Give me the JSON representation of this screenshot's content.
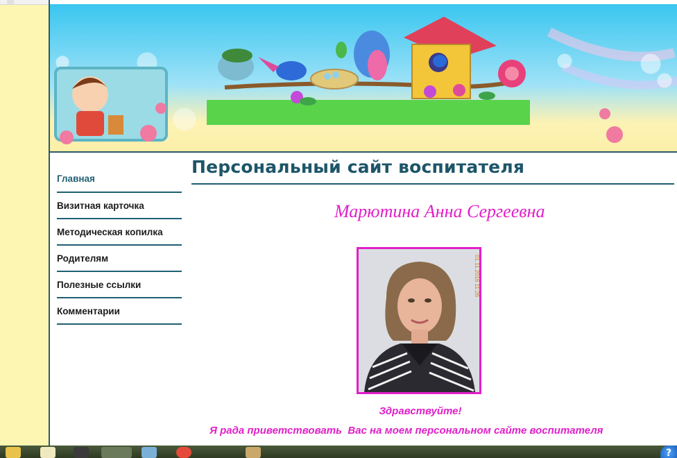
{
  "site": {
    "title": "Персональный сайт воспитателя"
  },
  "nav": {
    "items": [
      {
        "label": "Главная",
        "active": true
      },
      {
        "label": "Визитная карточка"
      },
      {
        "label": "Методическая копилка"
      },
      {
        "label": "Родителям"
      },
      {
        "label": "Полезные ссылки"
      },
      {
        "label": "Комментарии"
      }
    ]
  },
  "main": {
    "teacher_name": "Марютина Анна Сергеевна",
    "photo_stamp": "01.11.2016 11:26",
    "greeting": "Здравствуйте!",
    "welcome": "Я рада приветствовать  Вас на моем персональном сайте воспитателя"
  },
  "taskbar": {
    "help_label": "?"
  },
  "colors": {
    "accent": "#1f5f72",
    "highlight": "#e020c8",
    "page_bg": "#fdf6b3"
  },
  "icons": {
    "banner": "kids-birds-birdhouse-banner",
    "taskbar": [
      "folder-icon",
      "user-icon",
      "bag-icon",
      "yandex-icon",
      "audio-icon",
      "chrome-icon",
      "paint-icon",
      "help-icon"
    ]
  }
}
